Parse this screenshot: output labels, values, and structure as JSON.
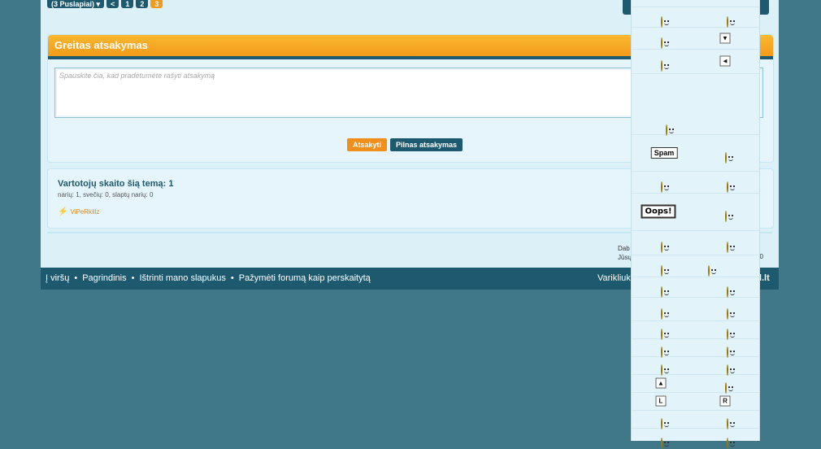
{
  "pagination": {
    "pages_label": "(3 Puslapiai)",
    "prev": "<",
    "pages": [
      "1",
      "2",
      "3"
    ],
    "current": "3"
  },
  "quick_reply": {
    "title": "Greitas atsakymas",
    "placeholder": "Spauskite čia, kad pradėtumėte rašyti atsakymą",
    "submit": "Atsakyti",
    "full": "Pilnas atsakymas"
  },
  "viewers": {
    "title": "Vartotojų skaito šią temą: 1",
    "summary": "narių: 1, svečių: 0, slaptų narių: 0",
    "user": "ViPeRkillz"
  },
  "stats": {
    "line1": "Dab",
    "line2": "Jūsų",
    "line3": "30"
  },
  "footer": {
    "links": [
      "Į viršų",
      "Pagrindinis",
      "Ištrinti mano slapukus",
      "Pažymėti forumą kaip perskaitytą"
    ],
    "separator": "•",
    "right": "Varikliuk",
    "right2": "rd.lt"
  },
  "smilies": {
    "spam": "Spam",
    "oops": "Oops!",
    "keys": {
      "down": "▼",
      "left": "◄",
      "up": "▲",
      "L": "L",
      "R": "R"
    }
  },
  "colors": {
    "background": "#40788a",
    "page": "#dcf0f8",
    "accent": "#f39a1c",
    "dark": "#1d5a70"
  }
}
